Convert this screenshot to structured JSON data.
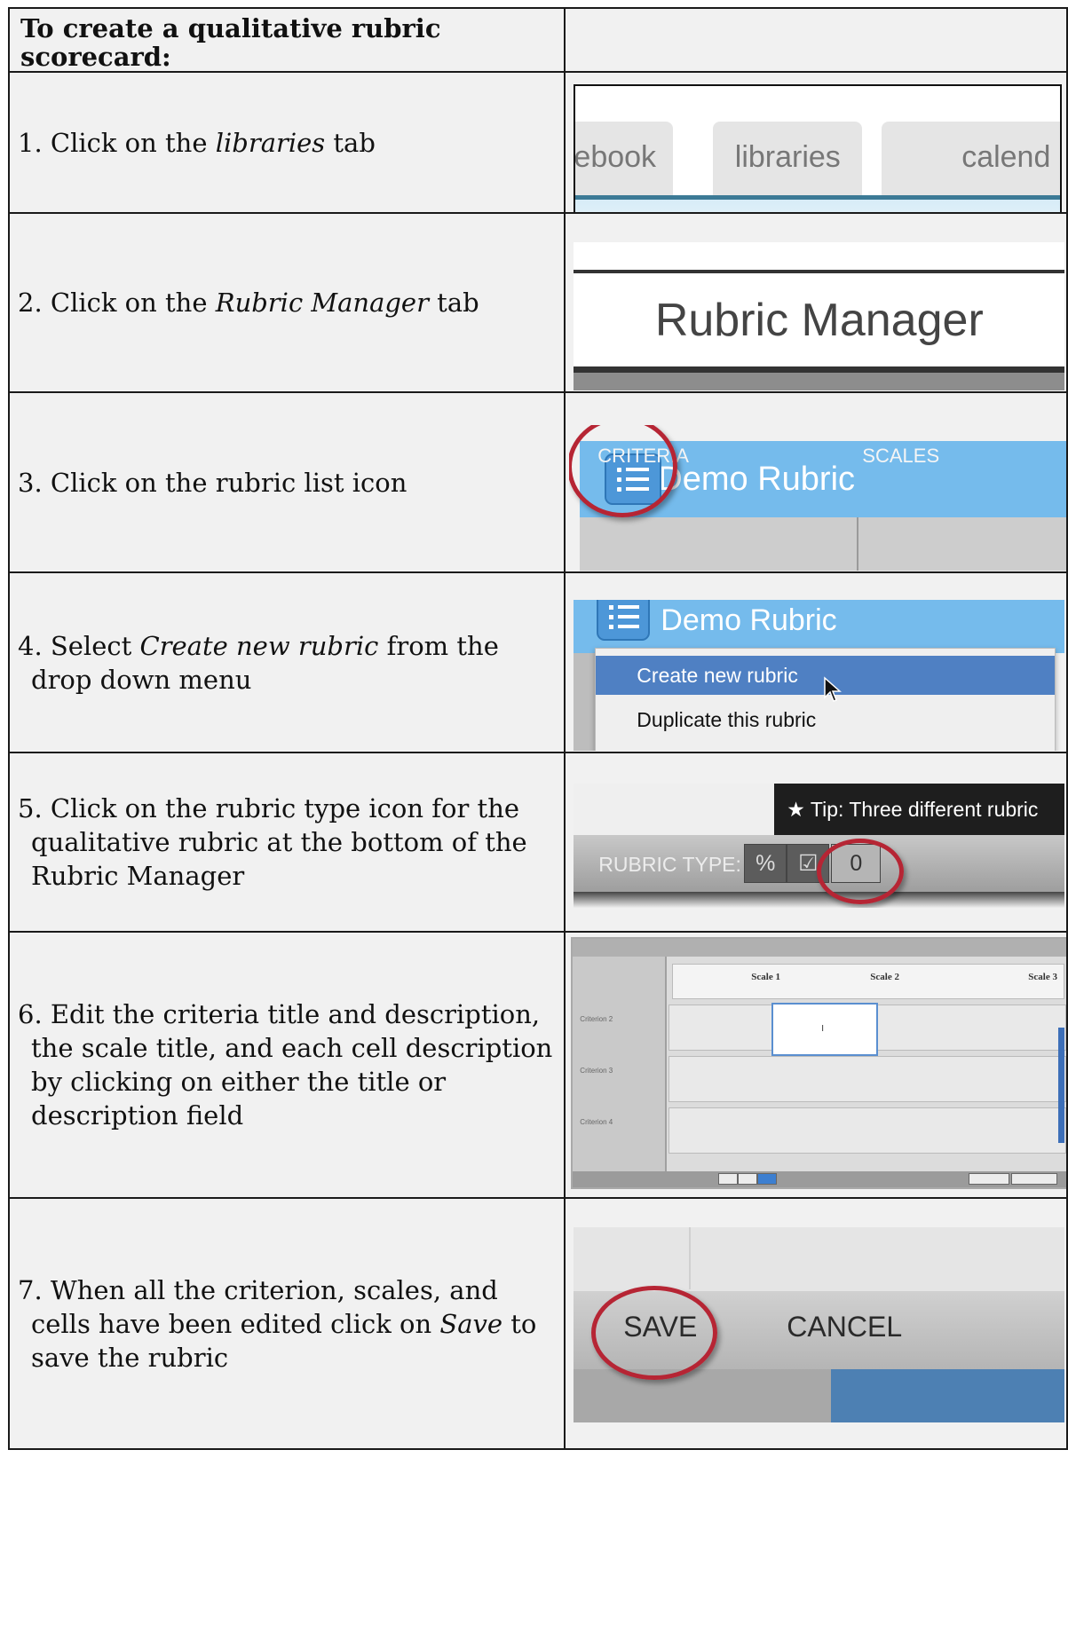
{
  "heading": "To create a qualitative rubric scorecard:",
  "steps": [
    {
      "pre": "1. Click on the ",
      "em": "libraries",
      "post": " tab"
    },
    {
      "pre": "2. Click on the ",
      "em": "Rubric Manager",
      "post": " tab"
    },
    {
      "pre": "3. Click on the rubric list icon",
      "em": "",
      "post": ""
    },
    {
      "pre": "4. Select ",
      "em": "Create new rubric",
      "post": " from the drop down menu"
    },
    {
      "pre": "5. Click on the rubric type icon for the qualitative rubric at the bottom of the Rubric Manager",
      "em": "",
      "post": ""
    },
    {
      "pre": "6. Edit the criteria title and description, the scale title, and each cell description by clicking on either the title or description field",
      "em": "",
      "post": ""
    },
    {
      "pre": "7. When all the criterion, scales, and cells have been edited click on ",
      "em": "Save",
      "post": " to save the rubric"
    }
  ],
  "shot1": {
    "tabs": [
      "debook",
      "libraries",
      "calend"
    ]
  },
  "shot2": {
    "label": "Rubric Manager"
  },
  "shot3": {
    "title": "Demo Rubric",
    "col1": "CRITERIA",
    "col2": "SCALES"
  },
  "shot4": {
    "title": "Demo Rubric",
    "item_selected": "Create new rubric",
    "item_other": "Duplicate this rubric"
  },
  "shot5": {
    "tip": "★  Tip: Three different rubric",
    "label": "RUBRIC TYPE:",
    "btn_percent": "%",
    "btn_edit": "☑",
    "btn_zero": "0"
  },
  "shot6": {
    "scales": [
      "Scale 1",
      "Scale 2",
      "Scale 3"
    ],
    "criteria": [
      "Criterion 2",
      "Criterion 3",
      "Criterion 4"
    ],
    "cell_value": "I"
  },
  "shot7": {
    "save": "SAVE",
    "cancel": "CANCEL"
  }
}
